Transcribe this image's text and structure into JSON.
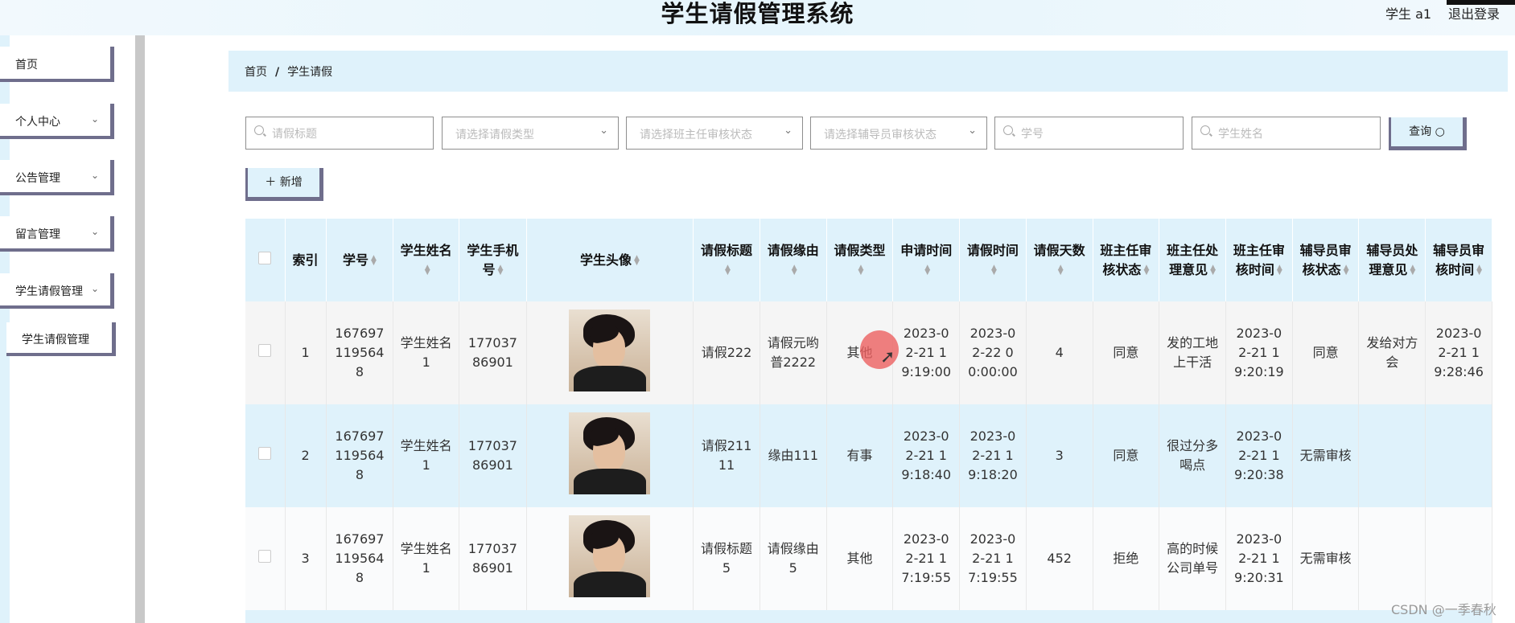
{
  "header": {
    "title": "学生请假管理系统",
    "user": "学生 a1",
    "logout": "退出登录"
  },
  "sidebar": {
    "items": [
      {
        "label": "首页",
        "chevron": ""
      },
      {
        "label": "个人中心",
        "chevron": "⌄"
      },
      {
        "label": "公告管理",
        "chevron": "⌄"
      },
      {
        "label": "留言管理",
        "chevron": "⌄"
      },
      {
        "label": "学生请假管理",
        "chevron": "⌄"
      }
    ],
    "sub_item": "学生请假管理"
  },
  "breadcrumb": {
    "home": "首页",
    "separator": "/",
    "current": "学生请假"
  },
  "search": {
    "title_placeholder": "请假标题",
    "type_placeholder": "请选择请假类型",
    "head_status_placeholder": "请选择班主任审核状态",
    "counselor_status_placeholder": "请选择辅导员审核状态",
    "id_placeholder": "学号",
    "name_placeholder": "学生姓名",
    "query_label": "查询 ○",
    "add_label": "＋ 新增"
  },
  "table": {
    "headers": [
      "索引",
      "学号",
      "学生姓名",
      "学生手机号",
      "学生头像",
      "请假标题",
      "请假缘由",
      "请假类型",
      "申请时间",
      "请假时间",
      "请假天数",
      "班主任审核状态",
      "班主任处理意见",
      "班主任审核时间",
      "辅导员审核状态",
      "辅导员处理意见",
      "辅导员审核时间"
    ],
    "rows": [
      {
        "index": "1",
        "student_id": "1676971195648",
        "name": "学生姓名1",
        "phone": "17703786901",
        "title": "请假222",
        "reason": "请假元哟普2222",
        "type": "其他",
        "apply_time": "2023-02-21 19:19:00",
        "leave_time": "2023-02-22 00:00:00",
        "days": "4",
        "head_status": "同意",
        "head_opinion": "发的工地上干活",
        "head_time": "2023-02-21 19:20:19",
        "counselor_status": "同意",
        "counselor_opinion": "发给对方会",
        "counselor_time": "2023-02-21 19:28:46"
      },
      {
        "index": "2",
        "student_id": "1676971195648",
        "name": "学生姓名1",
        "phone": "17703786901",
        "title": "请假21111",
        "reason": "缘由111",
        "type": "有事",
        "apply_time": "2023-02-21 19:18:40",
        "leave_time": "2023-02-21 19:18:20",
        "days": "3",
        "head_status": "同意",
        "head_opinion": "很过分多喝点",
        "head_time": "2023-02-21 19:20:38",
        "counselor_status": "无需审核",
        "counselor_opinion": "",
        "counselor_time": ""
      },
      {
        "index": "3",
        "student_id": "1676971195648",
        "name": "学生姓名1",
        "phone": "17703786901",
        "title": "请假标题5",
        "reason": "请假缘由5",
        "type": "其他",
        "apply_time": "2023-02-21 17:19:55",
        "leave_time": "2023-02-21 17:19:55",
        "days": "452",
        "head_status": "拒绝",
        "head_opinion": "高的时候公司单号",
        "head_time": "2023-02-21 19:20:31",
        "counselor_status": "无需审核",
        "counselor_opinion": "",
        "counselor_time": ""
      }
    ]
  },
  "icons": {
    "search": "search-icon",
    "chevron": "chevron-down-icon",
    "plus": "plus-icon"
  },
  "colors": {
    "accent": "#dff2fb",
    "border": "#6f6e8c",
    "cursor": "#ec6060"
  },
  "watermark": "CSDN @一季春秋"
}
